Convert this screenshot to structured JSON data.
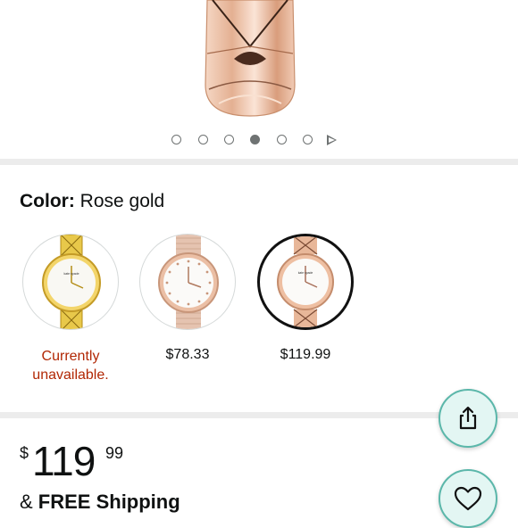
{
  "carousel": {
    "total_dots": 6,
    "active_index": 3,
    "has_next_arrow": true,
    "icons": [
      "dot-icon",
      "next-arrow-icon"
    ]
  },
  "color_selector": {
    "label": "Color:",
    "selected_value": "Rose gold",
    "swatches": [
      {
        "name": "gold",
        "price": "",
        "status_line1": "Currently",
        "status_line2": "unavailable.",
        "selected": false
      },
      {
        "name": "rose-gold-mesh",
        "price": "$78.33",
        "status_line1": "",
        "status_line2": "",
        "selected": false
      },
      {
        "name": "rose-gold",
        "price": "$119.99",
        "status_line1": "",
        "status_line2": "",
        "selected": true
      }
    ]
  },
  "price": {
    "currency": "$",
    "whole": "119",
    "fraction": "99"
  },
  "shipping": {
    "prefix": "& ",
    "text": "FREE Shipping"
  },
  "actions": {
    "share_icon": "share-icon",
    "wishlist_icon": "heart-icon"
  },
  "colors": {
    "accent_teal": "#5bb7aa",
    "fab_bg": "#e3f6f3",
    "unavailable_red": "#b12704",
    "rose_gold": "#e6b8a0",
    "gold": "#e9c94a"
  }
}
